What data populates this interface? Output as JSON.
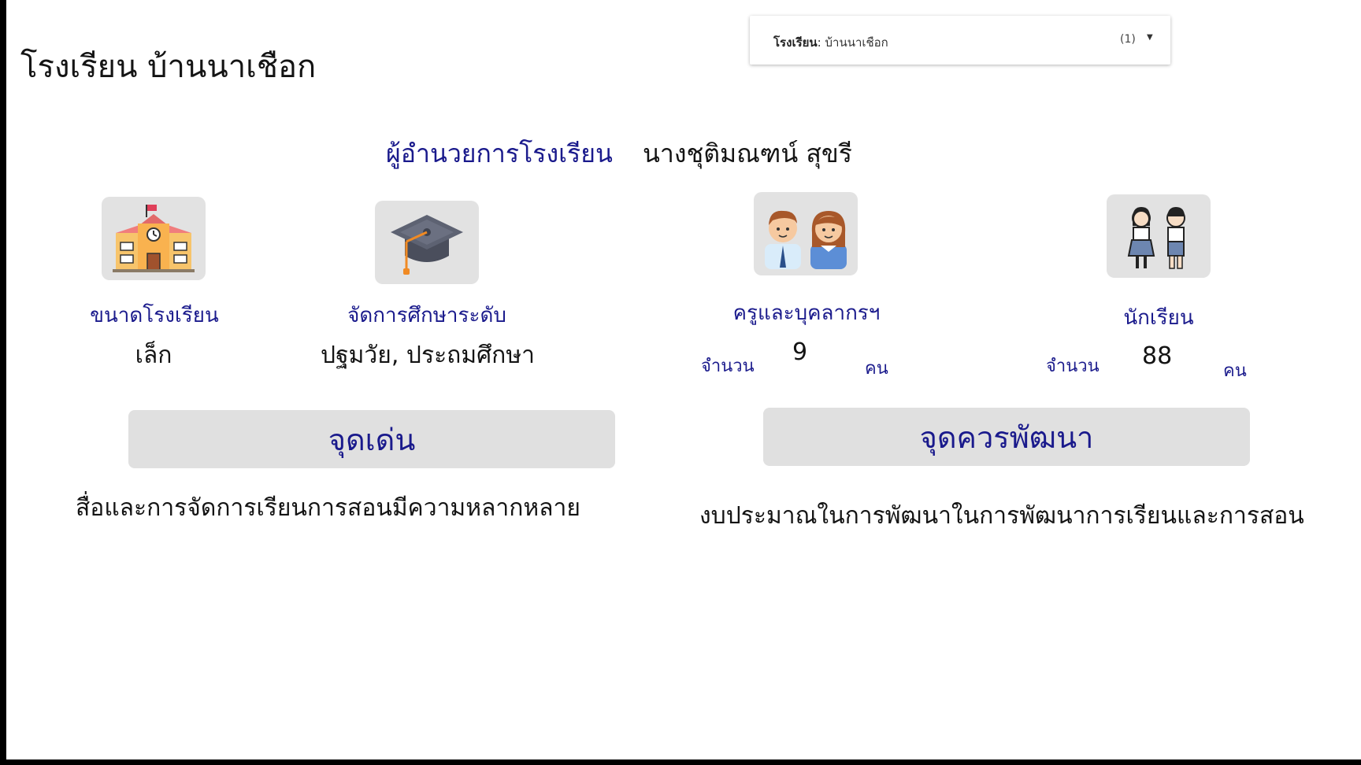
{
  "school": {
    "title": "โรงเรียน บ้านนาเชือก"
  },
  "filter": {
    "label": "โรงเรียน",
    "value": ": บ้านนาเชือก",
    "count": "(1)"
  },
  "director": {
    "label": "ผู้อำนวยการโรงเรียน",
    "name": "นางชุติมณฑน์ สุขรี"
  },
  "stats": {
    "size": {
      "label": "ขนาดโรงเรียน",
      "value": "เล็ก"
    },
    "level": {
      "label": "จัดการศึกษาระดับ",
      "value": "ปฐมวัย, ประถมศึกษา"
    },
    "staff": {
      "label": "ครูและบุคลากรฯ",
      "count_label": "จำนวน",
      "count": "9",
      "unit": "คน"
    },
    "students": {
      "label": "นักเรียน",
      "count_label": "จำนวน",
      "count": "88",
      "unit": "คน"
    }
  },
  "sections": {
    "strength": {
      "header": "จุดเด่น",
      "text": "สื่อและการจัดการเรียนการสอนมีความหลากหลาย"
    },
    "improve": {
      "header": "จุดควรพัฒนา",
      "text": "งบประมาณในการพัฒนาในการพัฒนาการเรียนและการสอน"
    }
  },
  "icons": {
    "school": "school-building-icon",
    "graduation": "graduation-cap-icon",
    "teachers": "teachers-icon",
    "students": "students-icon"
  },
  "colors": {
    "accent": "#1a1a8c",
    "tile": "#e2e2e2"
  }
}
